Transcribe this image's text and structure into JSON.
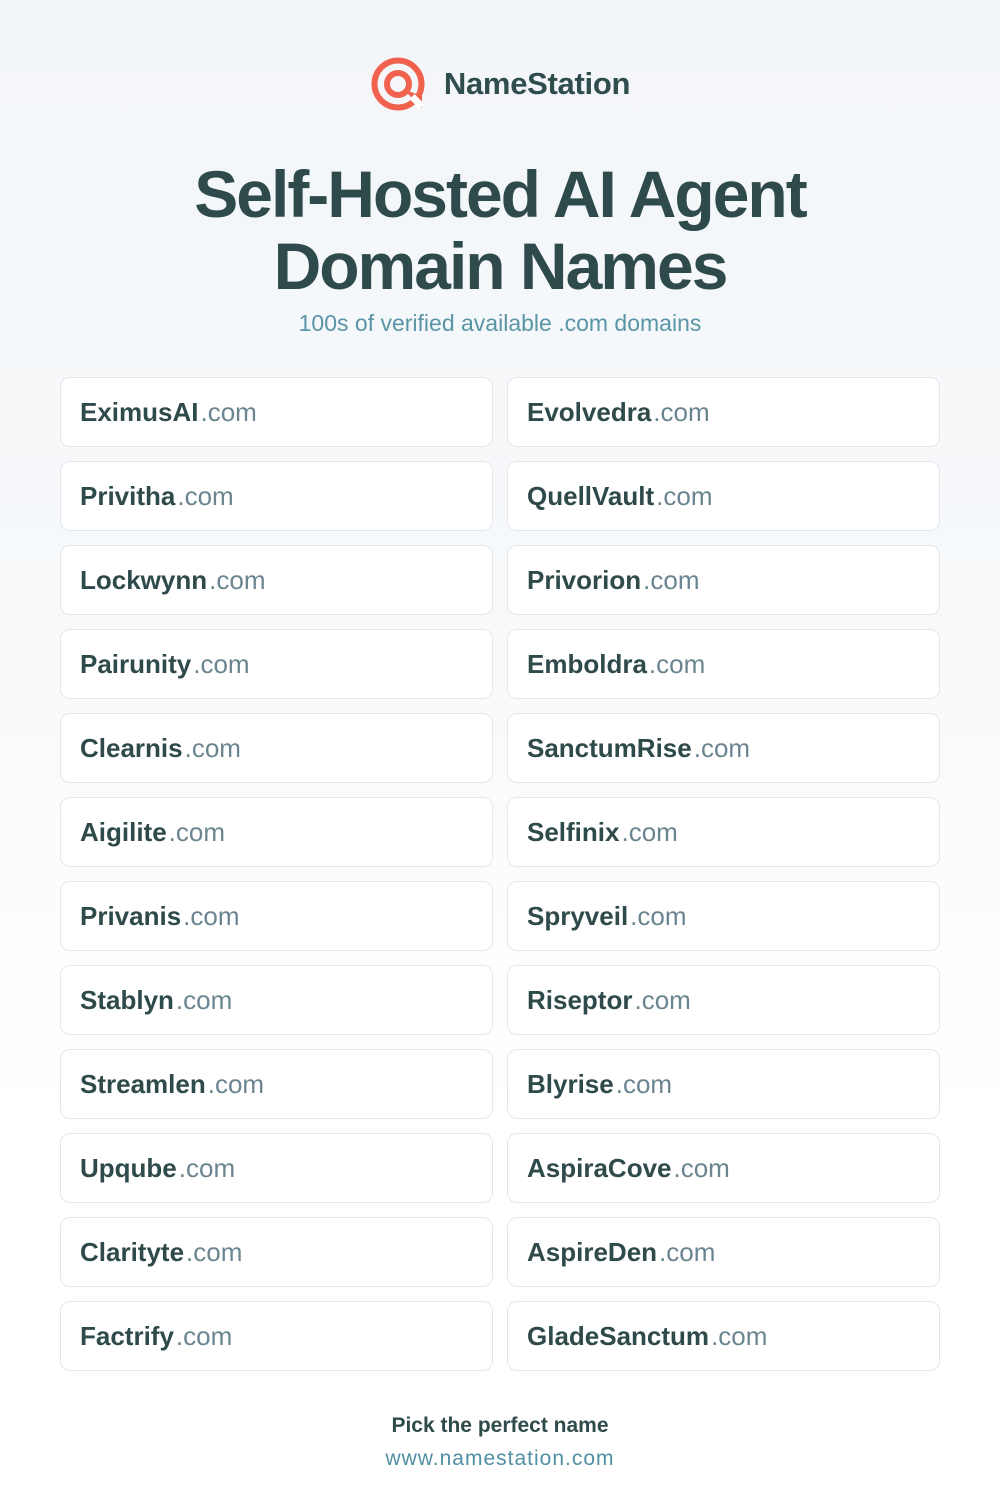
{
  "brand": {
    "name": "NameStation",
    "logo_icon": "target-search-icon",
    "logo_color": "#f0624d"
  },
  "headline": {
    "line1": "Self-Hosted AI Agent",
    "line2": "Domain Names"
  },
  "subtitle": "100s of verified available .com domains",
  "tld": ".com",
  "domains": [
    "EximusAI",
    "Evolvedra",
    "Privitha",
    "QuellVault",
    "Lockwynn",
    "Privorion",
    "Pairunity",
    "Emboldra",
    "Clearnis",
    "SanctumRise",
    "Aigilite",
    "Selfinix",
    "Privanis",
    "Spryveil",
    "Stablyn",
    "Riseptor",
    "Streamlen",
    "Blyrise",
    "Upqube",
    "AspiraCove",
    "Clarityte",
    "AspireDen",
    "Factrify",
    "GladeSanctum"
  ],
  "footer": {
    "cta": "Pick the perfect name",
    "url": "www.namestation.com"
  },
  "colors": {
    "heading": "#2f4a4a",
    "tld": "#6b8590",
    "accent_teal": "#5a95a6",
    "card_border": "#e3e8ec"
  }
}
